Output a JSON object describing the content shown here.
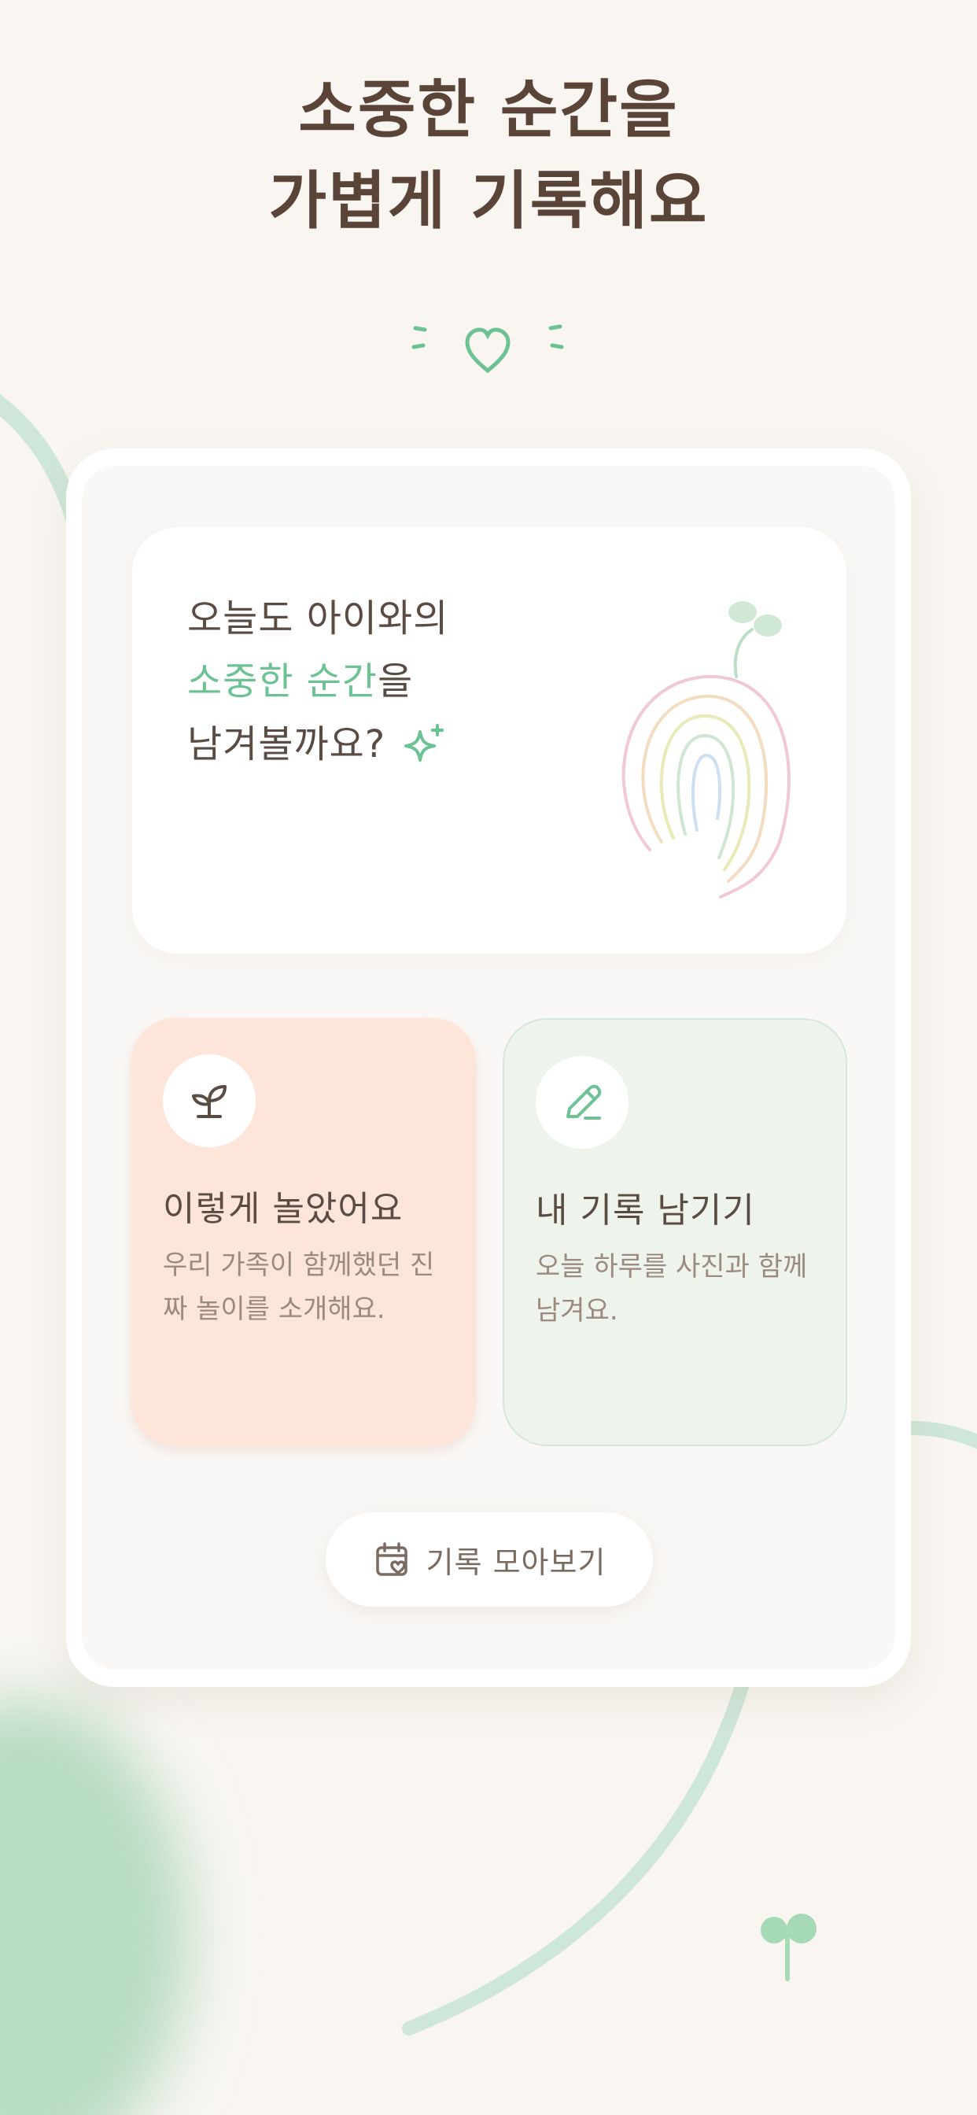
{
  "headline": {
    "line1": "소중한 순간을",
    "line2": "가볍게 기록해요"
  },
  "hero": {
    "line1": "오늘도 아이와의",
    "line2_accent": "소중한 순간",
    "line2_rest": "을",
    "line3": "남겨볼까요?"
  },
  "tiles": [
    {
      "title": "이렇게 놀았어요",
      "desc": "우리 가족이 함께했던 진짜 놀이를 소개해요.",
      "icon": "sprout-icon"
    },
    {
      "title": "내 기록 남기기",
      "desc": "오늘 하루를 사진과 함께 남겨요.",
      "icon": "pencil-icon"
    }
  ],
  "collection_button": {
    "label": "기록 모아보기",
    "icon": "calendar-heart-icon"
  },
  "colors": {
    "background": "#f9f6f1",
    "accent_green": "#6dc294",
    "headline_brown": "#5a4438",
    "tile_peach": "#fde5da",
    "tile_mint": "#eef3ec"
  }
}
